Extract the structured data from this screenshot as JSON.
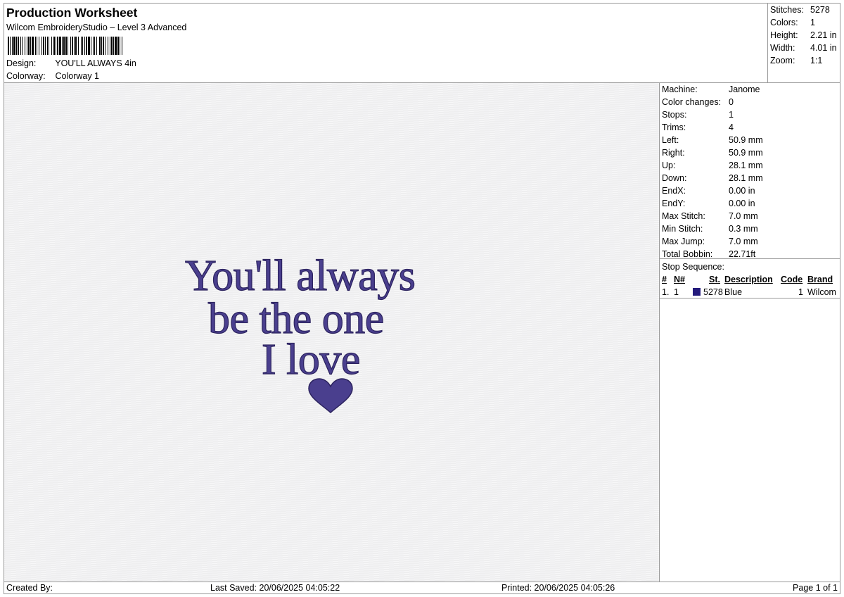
{
  "header": {
    "title": "Production Worksheet",
    "software": "Wilcom EmbroideryStudio – Level 3 Advanced",
    "design_label": "Design:",
    "design_value": "YOU'LL ALWAYS 4in",
    "colorway_label": "Colorway:",
    "colorway_value": "Colorway 1"
  },
  "stats": [
    {
      "label": "Stitches:",
      "value": "5278"
    },
    {
      "label": "Colors:",
      "value": "1"
    },
    {
      "label": "Height:",
      "value": "2.21 in"
    },
    {
      "label": "Width:",
      "value": "4.01 in"
    },
    {
      "label": "Zoom:",
      "value": "1:1"
    }
  ],
  "design": {
    "lines": [
      "You'll always",
      "be the one",
      "I love"
    ],
    "thread_color": "#4a3f8e",
    "shape_icon": "heart-icon"
  },
  "details": [
    {
      "label": "Machine:",
      "value": "Janome"
    },
    {
      "label": "Color changes:",
      "value": "0"
    },
    {
      "label": "Stops:",
      "value": "1"
    },
    {
      "label": "Trims:",
      "value": "4"
    },
    {
      "label": "Left:",
      "value": "50.9 mm"
    },
    {
      "label": "Right:",
      "value": "50.9 mm"
    },
    {
      "label": "Up:",
      "value": "28.1 mm"
    },
    {
      "label": "Down:",
      "value": "28.1 mm"
    },
    {
      "label": "EndX:",
      "value": "0.00 in"
    },
    {
      "label": "EndY:",
      "value": "0.00 in"
    },
    {
      "label": "Max Stitch:",
      "value": "7.0 mm"
    },
    {
      "label": "Min Stitch:",
      "value": "0.3 mm"
    },
    {
      "label": "Max Jump:",
      "value": "7.0 mm"
    },
    {
      "label": "Total Bobbin:",
      "value": "22.71ft"
    }
  ],
  "stop_sequence": {
    "title": "Stop Sequence:",
    "columns": [
      "#",
      "N#",
      "St.",
      "Description",
      "Code",
      "Brand"
    ],
    "rows": [
      {
        "index": "1.",
        "n": "1",
        "stitches": "5278",
        "description": "Blue",
        "code": "1",
        "brand": "Wilcom",
        "color": "#241a7c"
      }
    ]
  },
  "footer": {
    "created_by": "Created By:",
    "last_saved": "Last Saved: 20/06/2025 04:05:22",
    "printed": "Printed: 20/06/2025 04:05:26",
    "page": "Page 1 of 1"
  }
}
